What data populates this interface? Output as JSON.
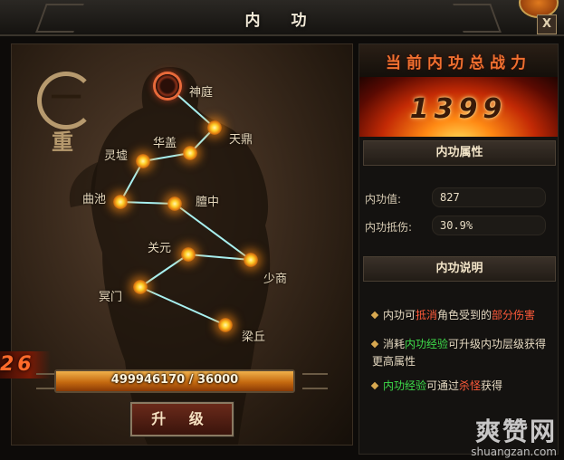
{
  "window": {
    "title": "内 功",
    "close_label": "X"
  },
  "left": {
    "tier_main": "一",
    "tier_sub": "重",
    "acupoints": [
      {
        "id": "shenting",
        "label": "神庭",
        "state": "start"
      },
      {
        "id": "tianding",
        "label": "天鼎",
        "state": "lit"
      },
      {
        "id": "huagai",
        "label": "华盖",
        "state": "lit"
      },
      {
        "id": "lingxu",
        "label": "灵墟",
        "state": "lit"
      },
      {
        "id": "quchi",
        "label": "曲池",
        "state": "lit"
      },
      {
        "id": "tanzhong",
        "label": "膻中",
        "state": "lit"
      },
      {
        "id": "guanyuan",
        "label": "关元",
        "state": "lit"
      },
      {
        "id": "shaoshang",
        "label": "少商",
        "state": "lit"
      },
      {
        "id": "mingmen",
        "label": "冥门",
        "state": "lit"
      },
      {
        "id": "liangqiu",
        "label": "梁丘",
        "state": "lit"
      }
    ],
    "level": "26",
    "exp_text": "499946170 / 36000",
    "exp_fill": 1.0,
    "upgrade_label": "升 级"
  },
  "right": {
    "power_header": "当前内功总战力",
    "power_value": "1399",
    "attr_header": "内功属性",
    "attrs": [
      {
        "label": "内功值:",
        "value": "827"
      },
      {
        "label": "内功抵伤:",
        "value": "30.9%"
      }
    ],
    "desc_header": "内功说明",
    "desc": [
      {
        "p1": "内功可",
        "hl": "抵消",
        "p2": "角色受到的",
        "hl2": "部分伤害"
      },
      {
        "p1": "消耗",
        "hl": "内功经验",
        "p2": "可升级内功层级获得更高属性"
      },
      {
        "p1": "",
        "hl": "内功经验",
        "p2": "可通过",
        "hl2": "杀怪",
        "p3": "获得"
      }
    ]
  },
  "watermark": {
    "main": "爽赞网",
    "url": "shuangzan.com"
  },
  "colors": {
    "accent": "#f07030",
    "green": "#3edc4a",
    "red": "#ff5a3a",
    "gold": "#d8a850"
  }
}
